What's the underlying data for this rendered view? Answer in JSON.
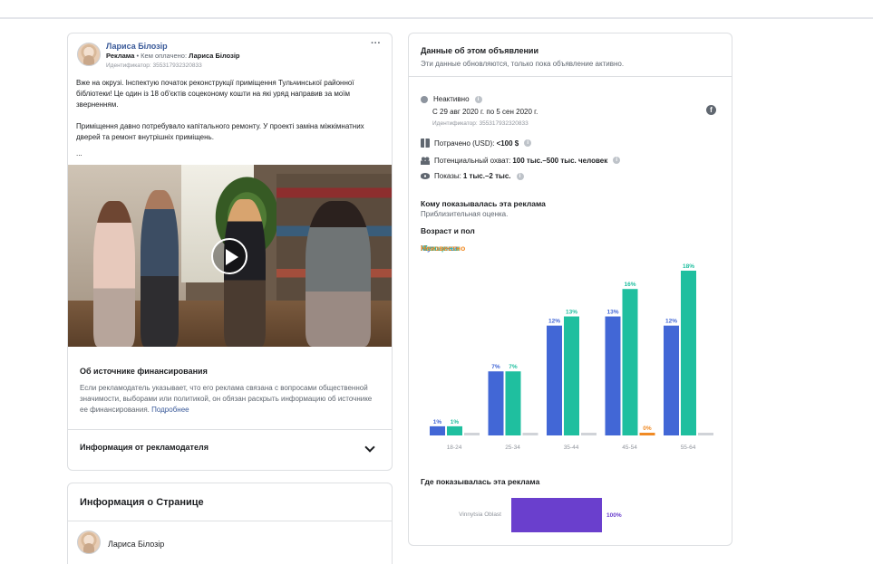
{
  "post": {
    "author": "Лариса Білозір",
    "sponsored_label": "Реклама",
    "paid_by_prefix": " • Кем оплачено: ",
    "paid_by": "Лариса Білозір",
    "identifier": "Идентификатор: 355317932320833",
    "more_icon": "more-dots-icon",
    "paragraph1": "Вже на окрузі. Інспектую початок реконструкції приміщення Тульчинської районної бібліотеки! Це один із 18 об'єктів соцеконому кошти на які уряд направив за моїм зверненням.",
    "paragraph2": "Приміщення давно потребувало капітального ремонту. У проекті заміна міжкімнатних дверей та ремонт внутрішніх приміщень.",
    "ellipsis": "..."
  },
  "funding": {
    "title": "Об источнике финансирования",
    "text": "Если рекламодатель указывает, что его реклама связана с вопросами общественной значимости, выборами или политикой, он обязан раскрыть информацию об источнике ее финансирования.",
    "link": "Подробнее"
  },
  "advertiser_info": {
    "label": "Информация от рекламодателя"
  },
  "page_info": {
    "title": "Информация о Странице",
    "page_name": "Лариса Білозір"
  },
  "ad_data": {
    "title": "Данные об этом объявлении",
    "subtitle": "Эти данные обновляются, только пока объявление активно.",
    "status": "Неактивно",
    "dates": "С 29 авг 2020 г. по 5 сен 2020 г.",
    "identifier": "Идентификатор: 355317932320833",
    "spent": "Потрачено (USD): ",
    "spent_value": "<100 $",
    "reach": "Потенциальный охват: ",
    "reach_value": "100 тыс.–500 тыс. человек",
    "impressions": "Показы: ",
    "impressions_value": "1 тыс.–2 тыс.",
    "shown_title": "Кому показывалась эта реклама",
    "shown_sub": "Приблизительная оценка.",
    "age_gender_title": "Возраст и пол",
    "where_title": "Где показывалась эта реклама",
    "region": "Vinnytsia Oblast",
    "region_pct": "100%",
    "region_value": 100
  },
  "colors": {
    "male": "#4267d6",
    "female": "#1fbf9f",
    "unknown": "#f08a24",
    "region": "#6a3fcd"
  },
  "chart_data": {
    "type": "bar",
    "categories": [
      "18-24",
      "25-34",
      "35-44",
      "45-54",
      "55-64"
    ],
    "series": [
      {
        "name": "Мужчины",
        "values": [
          1,
          7,
          12,
          13,
          12
        ],
        "labels": [
          "1%",
          "7%",
          "12%",
          "13%",
          "12%"
        ]
      },
      {
        "name": "Женщины",
        "values": [
          1,
          7,
          13,
          16,
          18
        ],
        "labels": [
          "1%",
          "7%",
          "13%",
          "16%",
          "18%"
        ]
      },
      {
        "name": "Неизвестно",
        "values": [
          0,
          0,
          0,
          0,
          0
        ],
        "labels": [
          "",
          "",
          "",
          "0%",
          ""
        ]
      }
    ],
    "ylim": [
      0,
      18
    ],
    "legend": "top-left"
  }
}
